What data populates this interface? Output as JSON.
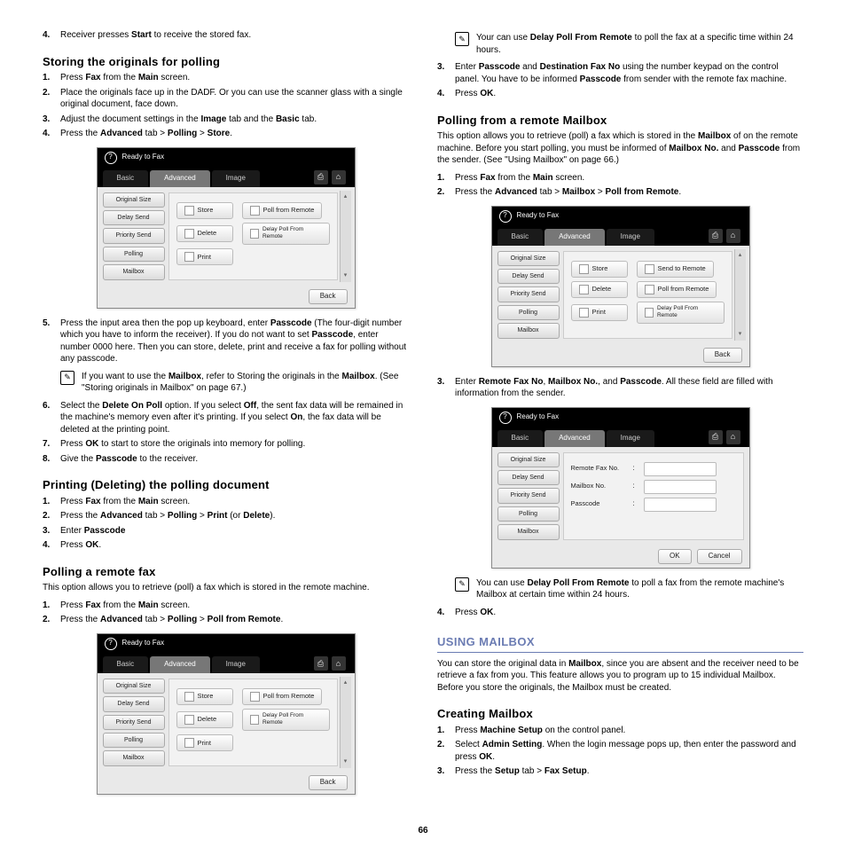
{
  "page_number": "66",
  "left": {
    "item4": "Receiver presses <b>Start</b> to receive the stored fax.",
    "storing_heading": "Storing the originals for polling",
    "storing": [
      "Press <b>Fax</b> from the <b>Main</b> screen.",
      "Place the originals face up in the DADF. Or you can use the scanner glass with a single original document, face down.",
      "Adjust the document settings in the <b>Image</b> tab and the <b>Basic</b> tab.",
      "Press the <b>Advanced</b> tab > <b>Polling</b> > <b>Store</b>."
    ],
    "storing5": "Press the input area then the pop up keyboard, enter <b>Passcode</b> (The four-digit number which you have to inform the receiver). If you do not want to set <b>Passcode</b>, enter number 0000 here. Then you can store, delete, print and receive a fax for polling without any passcode.",
    "storing_note": "If you want to use the <b>Mailbox</b>, refer to Storing the originals in the <b>Mailbox</b>. (See \"Storing originals in Mailbox\" on page 67.)",
    "storing6": "Select the <b>Delete On Poll</b> option. If you select <b>Off</b>, the sent fax data will be remained in the machine's memory even after it's printing. If you select <b>On</b>, the fax data will be deleted at the printing point.",
    "storing7": "Press <b>OK</b> to start to store the originals into memory for polling.",
    "storing8": "Give the <b>Passcode</b> to the receiver.",
    "printing_heading": "Printing (Deleting) the polling document",
    "printing": [
      "Press <b>Fax</b> from the <b>Main</b> screen.",
      "Press the <b>Advanced</b> tab > <b>Polling</b> > <b>Print</b> (or <b>Delete</b>).",
      "Enter <b>Passcode</b>",
      "Press <b>OK</b>."
    ],
    "remote_heading": "Polling a remote fax",
    "remote_body": "This option allows you to retrieve (poll) a fax which is stored in the remote machine.",
    "remote": [
      "Press <b>Fax</b> from the <b>Main</b> screen.",
      "Press the <b>Advanced</b> tab > <b>Polling</b> > <b>Poll from Remote</b>."
    ]
  },
  "right": {
    "top_note": "Your can use <b>Delay Poll From Remote</b> to poll the fax at a specific time within 24 hours.",
    "item3": "Enter <b>Passcode</b> and <b>Destination Fax No</b> using the number keypad on the control panel. You have to be informed <b>Passcode</b> from sender with the remote fax machine.",
    "item4": "Press <b>OK</b>.",
    "mailbox_heading": "Polling from a remote Mailbox",
    "mailbox_body": "This option allows you to retrieve (poll) a fax which is stored in the <b>Mailbox</b> of on the remote machine. Before you start polling, you must be informed of <b>Mailbox No.</b> and <b>Passcode</b> from the sender. (See \"Using Mailbox\" on page 66.)",
    "mailbox": [
      "Press <b>Fax</b> from the <b>Main</b> screen.",
      "Press the <b>Advanced</b> tab > <b>Mailbox</b> > <b>Poll from Remote</b>."
    ],
    "mailbox3": "Enter <b>Remote Fax No</b>, <b>Mailbox No.</b>, and <b>Passcode</b>. All these field are filled with information from the sender.",
    "mailbox_note": "You can use <b>Delay Poll From Remote</b> to poll a fax from the remote machine's Mailbox at certain time within 24 hours.",
    "mailbox4": "Press <b>OK</b>.",
    "using_heading": "USING MAILBOX",
    "using_body": "You can store the original data in <b>Mailbox</b>, since you are absent and the receiver need to be retrieve a fax from you. This feature allows you to program up to 15 individual Mailbox. Before you store the originals, the Mailbox must be created.",
    "creating_heading": "Creating Mailbox",
    "creating": [
      "Press <b>Machine Setup</b> on the control panel.",
      "Select <b>Admin Setting</b>. When the login message pops up, then enter the password and press <b>OK</b>.",
      "Press the <b>Setup</b> tab > <b>Fax Setup</b>."
    ]
  },
  "screenshots": {
    "title": "Ready to Fax",
    "tabs": {
      "basic": "Basic",
      "advanced": "Advanced",
      "image": "Image"
    },
    "side": [
      "Original Size",
      "Delay Send",
      "Priority Send",
      "Polling",
      "Mailbox"
    ],
    "a": {
      "rows": [
        [
          "Store",
          "Poll from Remote"
        ],
        [
          "Delete",
          "Delay Poll From Remote"
        ],
        [
          "Print",
          ""
        ]
      ],
      "footer": [
        "Back"
      ]
    },
    "b": {
      "rows": [
        [
          "Store",
          "Send to Remote"
        ],
        [
          "Delete",
          "Poll from Remote"
        ],
        [
          "Print",
          "Delay Poll From Remote"
        ]
      ],
      "footer": [
        "Back"
      ]
    },
    "c": {
      "fields": [
        "Remote Fax No.",
        "Mailbox No.",
        "Passcode"
      ],
      "footer": [
        "OK",
        "Cancel"
      ]
    }
  }
}
